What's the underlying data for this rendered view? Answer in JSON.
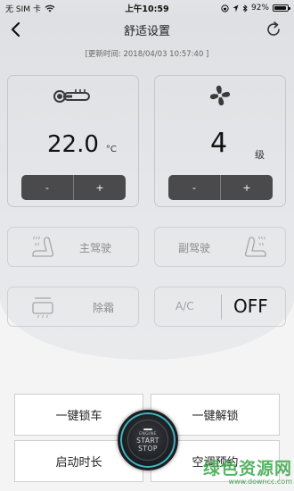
{
  "status_bar": {
    "carrier": "无 SIM 卡",
    "time": "上午10:59",
    "battery": "92%",
    "battery_level": 0.92
  },
  "header": {
    "title": "舒适设置"
  },
  "updated_text": "[更新时间:  2018/04/03 10:57:40 ]",
  "temperature": {
    "value": "22.0",
    "unit": "°C",
    "minus": "-",
    "plus": "+"
  },
  "fan": {
    "value": "4",
    "unit": "级",
    "minus": "-",
    "plus": "+"
  },
  "seat_driver": {
    "label": "主驾驶"
  },
  "seat_passenger": {
    "label": "副驾驶"
  },
  "defrost": {
    "label": "除霜"
  },
  "ac": {
    "label": "A/C",
    "state": "OFF"
  },
  "actions": {
    "lock": "一键锁车",
    "unlock": "一键解锁",
    "duration": "启动时长",
    "schedule": "空调预约"
  },
  "engine_button": {
    "top": "ENGINE",
    "line1": "START",
    "line2": "STOP"
  },
  "watermark": {
    "big": "绿色资源网",
    "small": "www.downcc.com"
  },
  "colors": {
    "accent_ring": "#3fb6c2",
    "stepper": "#4a4a4c",
    "watermark": "#3aa84a"
  }
}
